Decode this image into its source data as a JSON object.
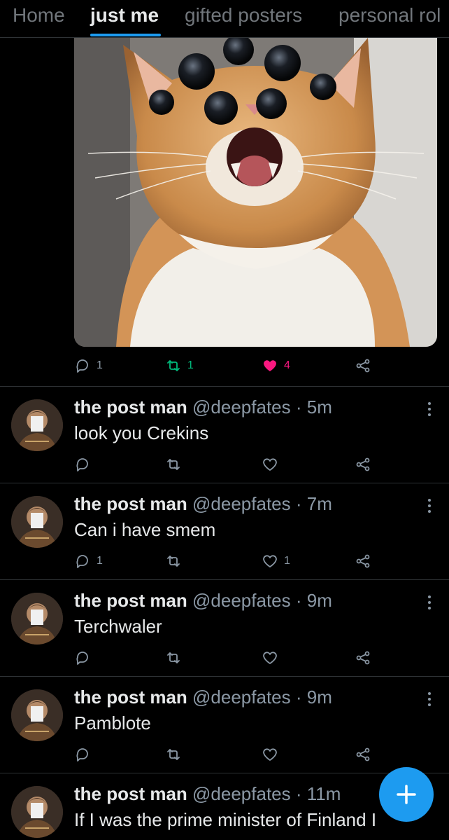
{
  "tabs": [
    {
      "label": "Home",
      "active": false
    },
    {
      "label": "just me",
      "active": true
    },
    {
      "label": "gifted posters",
      "active": false
    },
    {
      "label": "personal rol",
      "active": false
    }
  ],
  "media_post": {
    "image_alt_icon": "cat-with-many-eyes-image",
    "reply_count": "1",
    "retweet_count": "1",
    "like_count": "4"
  },
  "tweets": [
    {
      "name": "the post man",
      "handle": "@deepfates",
      "dot": "·",
      "time": "5m",
      "text": "look you Crekins",
      "reply_count": "",
      "retweet_count": "",
      "like_count": ""
    },
    {
      "name": "the post man",
      "handle": "@deepfates",
      "dot": "·",
      "time": "7m",
      "text": "Can i have smem",
      "reply_count": "1",
      "retweet_count": "",
      "like_count": "1"
    },
    {
      "name": "the post man",
      "handle": "@deepfates",
      "dot": "·",
      "time": "9m",
      "text": "Terchwaler",
      "reply_count": "",
      "retweet_count": "",
      "like_count": ""
    },
    {
      "name": "the post man",
      "handle": "@deepfates",
      "dot": "·",
      "time": "9m",
      "text": "Pamblote",
      "reply_count": "",
      "retweet_count": "",
      "like_count": ""
    },
    {
      "name": "the post man",
      "handle": "@deepfates",
      "dot": "·",
      "time": "11m",
      "text": "If I was the prime minister of Finland I",
      "reply_count": "",
      "retweet_count": "",
      "like_count": ""
    }
  ],
  "fab": {
    "icon": "plus-icon"
  },
  "colors": {
    "accent": "#1d9bf0",
    "like": "#f91880",
    "retweet": "#00ba7c",
    "muted": "#8b98a5"
  }
}
